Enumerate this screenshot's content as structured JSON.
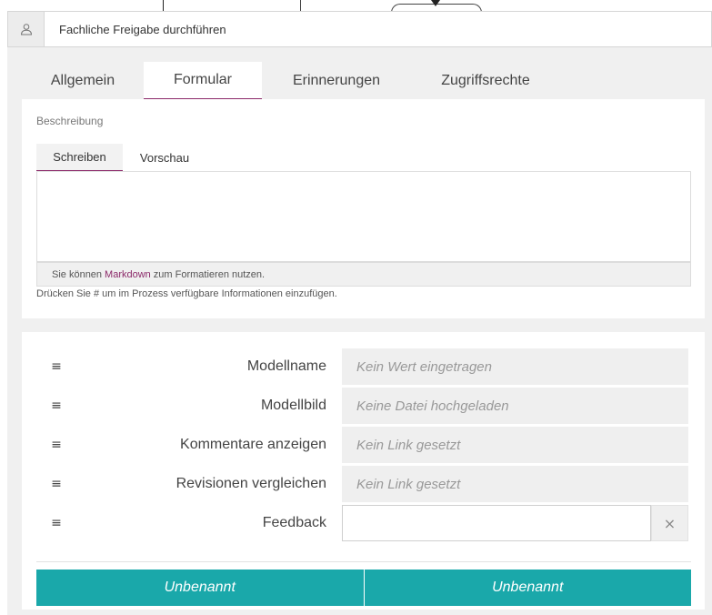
{
  "panel": {
    "title": "Fachliche Freigabe durchführen",
    "title_icon": "user-icon"
  },
  "tabs": [
    {
      "label": "Allgemein",
      "active": false
    },
    {
      "label": "Formular",
      "active": true
    },
    {
      "label": "Erinnerungen",
      "active": false
    },
    {
      "label": "Zugriffsrechte",
      "active": false
    }
  ],
  "description": {
    "label": "Beschreibung",
    "subtabs": [
      {
        "label": "Schreiben",
        "active": true
      },
      {
        "label": "Vorschau",
        "active": false
      }
    ],
    "editor_value": "",
    "footer_prefix": "Sie können",
    "footer_link": "Markdown",
    "footer_suffix": "zum Formatieren nutzen.",
    "hint": "Drücken Sie # um im Prozess verfügbare Informationen einzufügen."
  },
  "form": {
    "rows": [
      {
        "label": "Modellname",
        "value": "Kein Wert eingetragen"
      },
      {
        "label": "Modellbild",
        "value": "Keine Datei hochgeladen"
      },
      {
        "label": "Kommentare anzeigen",
        "value": "Kein Link gesetzt"
      },
      {
        "label": "Revisionen vergleichen",
        "value": "Kein Link gesetzt"
      },
      {
        "label": "Feedback",
        "value": ""
      }
    ],
    "drag_glyph": "≡",
    "clear_glyph": "×",
    "buttons": [
      {
        "label": "Unbenannt"
      },
      {
        "label": "Unbenannt"
      }
    ]
  },
  "colors": {
    "accent": "#8c2a6a",
    "button": "#1aa8aa",
    "panel_bg": "#f0f0f0"
  }
}
